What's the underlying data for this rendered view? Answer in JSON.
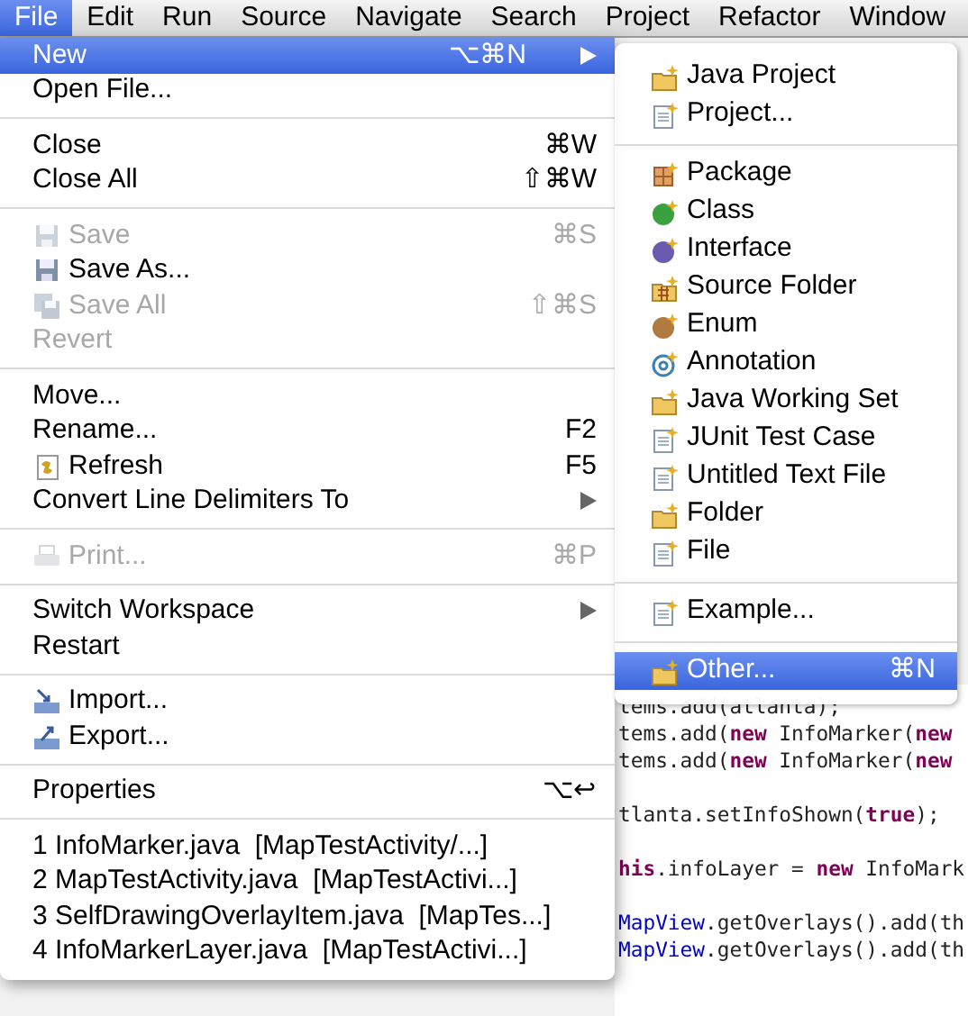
{
  "menubar": [
    {
      "label": "File",
      "selected": true
    },
    {
      "label": "Edit",
      "selected": false
    },
    {
      "label": "Run",
      "selected": false
    },
    {
      "label": "Source",
      "selected": false
    },
    {
      "label": "Navigate",
      "selected": false
    },
    {
      "label": "Search",
      "selected": false
    },
    {
      "label": "Project",
      "selected": false
    },
    {
      "label": "Refactor",
      "selected": false
    },
    {
      "label": "Window",
      "selected": false
    }
  ],
  "file_menu": [
    {
      "kind": "item",
      "label": "New",
      "shortcut": "⌥⌘N",
      "submenu": true,
      "selected": true,
      "disabled": false
    },
    {
      "kind": "item",
      "label": "Open File...",
      "selected": false,
      "disabled": false
    },
    {
      "kind": "separator"
    },
    {
      "kind": "item",
      "label": "Close",
      "shortcut": "⌘W",
      "selected": false,
      "disabled": false
    },
    {
      "kind": "item",
      "label": "Close All",
      "shortcut": "⇧⌘W",
      "selected": false,
      "disabled": false
    },
    {
      "kind": "separator"
    },
    {
      "kind": "item",
      "label": "Save",
      "shortcut": "⌘S",
      "selected": false,
      "disabled": true
    },
    {
      "kind": "item",
      "label": "Save As...",
      "selected": false,
      "disabled": false
    },
    {
      "kind": "item",
      "label": "Save All",
      "shortcut": "⇧⌘S",
      "selected": false,
      "disabled": true
    },
    {
      "kind": "item",
      "label": "Revert",
      "selected": false,
      "disabled": true
    },
    {
      "kind": "separator"
    },
    {
      "kind": "item",
      "label": "Move...",
      "selected": false,
      "disabled": false
    },
    {
      "kind": "item",
      "label": "Rename...",
      "shortcut": "F2",
      "selected": false,
      "disabled": false
    },
    {
      "kind": "item",
      "label": "Refresh",
      "shortcut": "F5",
      "selected": false,
      "disabled": false
    },
    {
      "kind": "item",
      "label": "Convert Line Delimiters To",
      "submenu": true,
      "selected": false,
      "disabled": false
    },
    {
      "kind": "separator"
    },
    {
      "kind": "item",
      "label": "Print...",
      "shortcut": "⌘P",
      "selected": false,
      "disabled": true
    },
    {
      "kind": "separator"
    },
    {
      "kind": "item",
      "label": "Switch Workspace",
      "submenu": true,
      "selected": false,
      "disabled": false
    },
    {
      "kind": "item",
      "label": "Restart",
      "selected": false,
      "disabled": false
    },
    {
      "kind": "separator"
    },
    {
      "kind": "item",
      "label": "Import...",
      "selected": false,
      "disabled": false
    },
    {
      "kind": "item",
      "label": "Export...",
      "selected": false,
      "disabled": false
    },
    {
      "kind": "separator"
    },
    {
      "kind": "item",
      "label": "Properties",
      "shortcut": "⌥↩",
      "selected": false,
      "disabled": false
    },
    {
      "kind": "separator"
    },
    {
      "kind": "item",
      "label": "1 InfoMarker.java  [MapTestActivity/...]",
      "selected": false,
      "disabled": false
    },
    {
      "kind": "item",
      "label": "2 MapTestActivity.java  [MapTestActivi...]",
      "selected": false,
      "disabled": false
    },
    {
      "kind": "item",
      "label": "3 SelfDrawingOverlayItem.java  [MapTes...]",
      "selected": false,
      "disabled": false
    },
    {
      "kind": "item",
      "label": "4 InfoMarkerLayer.java  [MapTestActivi...]",
      "selected": false,
      "disabled": false
    }
  ],
  "new_submenu": [
    {
      "kind": "item",
      "label": "Java Project",
      "selected": false
    },
    {
      "kind": "item",
      "label": "Project...",
      "selected": false
    },
    {
      "kind": "separator"
    },
    {
      "kind": "item",
      "label": "Package",
      "selected": false
    },
    {
      "kind": "item",
      "label": "Class",
      "selected": false
    },
    {
      "kind": "item",
      "label": "Interface",
      "selected": false
    },
    {
      "kind": "item",
      "label": "Source Folder",
      "selected": false
    },
    {
      "kind": "item",
      "label": "Enum",
      "selected": false
    },
    {
      "kind": "item",
      "label": "Annotation",
      "selected": false
    },
    {
      "kind": "item",
      "label": "Java Working Set",
      "selected": false
    },
    {
      "kind": "item",
      "label": "JUnit Test Case",
      "selected": false
    },
    {
      "kind": "item",
      "label": "Untitled Text File",
      "selected": false
    },
    {
      "kind": "item",
      "label": "Folder",
      "selected": false
    },
    {
      "kind": "item",
      "label": "File",
      "selected": false
    },
    {
      "kind": "separator"
    },
    {
      "kind": "item",
      "label": "Example...",
      "selected": false
    },
    {
      "kind": "separator"
    },
    {
      "kind": "item",
      "label": "Other...",
      "shortcut": "⌘N",
      "selected": true
    }
  ],
  "code_lines": [
    [
      {
        "kind": "plain",
        "text": "tems.add(atlanta);"
      }
    ],
    [
      {
        "kind": "plain",
        "text": "tems.add("
      },
      {
        "kind": "keyword",
        "text": "new"
      },
      {
        "kind": "plain",
        "text": " InfoMarker("
      },
      {
        "kind": "keyword",
        "text": "new"
      }
    ],
    [
      {
        "kind": "plain",
        "text": "tems.add("
      },
      {
        "kind": "keyword",
        "text": "new"
      },
      {
        "kind": "plain",
        "text": " InfoMarker("
      },
      {
        "kind": "keyword",
        "text": "new"
      }
    ],
    [
      {
        "kind": "plain",
        "text": "tlanta.setInfoShown("
      },
      {
        "kind": "keyword",
        "text": "true"
      },
      {
        "kind": "plain",
        "text": ");"
      }
    ],
    [
      {
        "kind": "keyword",
        "text": "his"
      },
      {
        "kind": "plain",
        "text": ".infoLayer = "
      },
      {
        "kind": "keyword",
        "text": "new"
      },
      {
        "kind": "plain",
        "text": " InfoMark"
      }
    ],
    [
      {
        "kind": "field",
        "text": "MapView"
      },
      {
        "kind": "plain",
        "text": ".getOverlays().add(th"
      }
    ],
    [
      {
        "kind": "field",
        "text": "MapView"
      },
      {
        "kind": "plain",
        "text": ".getOverlays().add(th"
      }
    ]
  ]
}
